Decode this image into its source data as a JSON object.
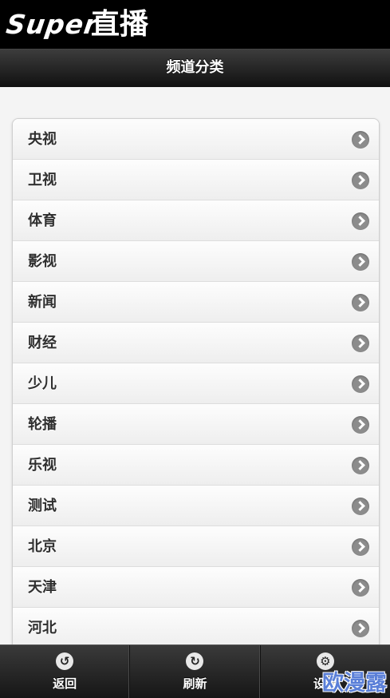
{
  "brand": {
    "logo_en": "Super",
    "logo_cn": "直播"
  },
  "header": {
    "title": "频道分类"
  },
  "channels": [
    {
      "label": "央视"
    },
    {
      "label": "卫视"
    },
    {
      "label": "体育"
    },
    {
      "label": "影视"
    },
    {
      "label": "新闻"
    },
    {
      "label": "财经"
    },
    {
      "label": "少儿"
    },
    {
      "label": "轮播"
    },
    {
      "label": "乐视"
    },
    {
      "label": "测试"
    },
    {
      "label": "北京"
    },
    {
      "label": "天津"
    },
    {
      "label": "河北"
    }
  ],
  "footer": {
    "back": {
      "label": "返回",
      "icon": "undo-icon"
    },
    "refresh": {
      "label": "刷新",
      "icon": "refresh-icon"
    },
    "settings": {
      "label": "设置",
      "icon": "gear-icon"
    }
  },
  "watermark": "欧漫露",
  "colors": {
    "header_bg": "#1a1a1a",
    "list_bg": "#f6f6f6",
    "arrow": "#8c8c8c"
  }
}
